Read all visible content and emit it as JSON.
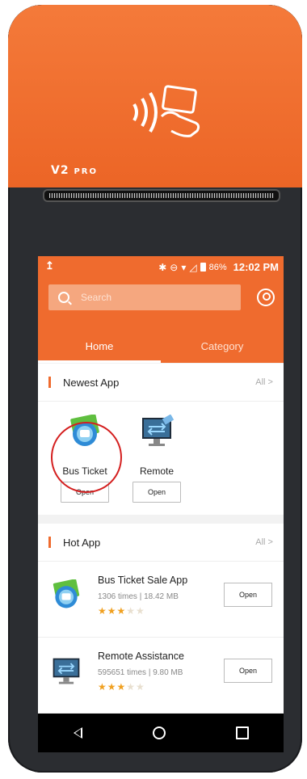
{
  "device": {
    "brand": "V2",
    "model": "PRO"
  },
  "statusbar": {
    "upload_icon": "upload-icon",
    "battery": "86%",
    "time": "12:02 PM"
  },
  "search": {
    "placeholder": "Search"
  },
  "tabs": [
    {
      "label": "Home"
    },
    {
      "label": "Category"
    }
  ],
  "newest": {
    "title": "Newest App",
    "all_label": "All >",
    "apps": [
      {
        "name": "Bus Ticket",
        "button": "Open"
      },
      {
        "name": "Remote",
        "button": "Open"
      }
    ]
  },
  "hot": {
    "title": "Hot App",
    "all_label": "All >",
    "apps": [
      {
        "name": "Bus Ticket Sale App",
        "meta": "1306 times | 18.42 MB",
        "stars": 3,
        "button": "Open"
      },
      {
        "name": "Remote Assistance",
        "meta": "595651 times | 9.80 MB",
        "stars": 3,
        "button": "Open"
      }
    ]
  },
  "colors": {
    "accent": "#ef6b2e",
    "highlight_circle": "#d41f1f"
  }
}
